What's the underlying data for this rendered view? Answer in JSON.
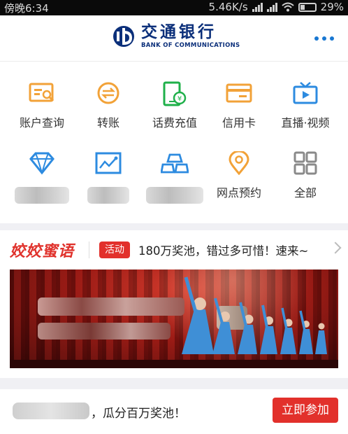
{
  "status_bar": {
    "time": "傍晚6:34",
    "network_speed": "5.46K/s",
    "battery": "29%"
  },
  "header": {
    "logo_cn": "交通银行",
    "logo_en": "BANK OF COMMUNICATIONS"
  },
  "menu_items": [
    {
      "label": "账户查询",
      "icon": "account-query-icon"
    },
    {
      "label": "转账",
      "icon": "transfer-icon"
    },
    {
      "label": "话费充值",
      "icon": "phone-recharge-icon"
    },
    {
      "label": "信用卡",
      "icon": "credit-card-icon"
    },
    {
      "label": "直播·视频",
      "icon": "live-video-icon"
    },
    {
      "label": "",
      "icon": "diamond-icon",
      "blurred": true
    },
    {
      "label": "",
      "icon": "chart-icon",
      "blurred": true
    },
    {
      "label": "",
      "icon": "gold-bars-icon",
      "blurred": true
    },
    {
      "label": "网点预约",
      "icon": "location-pin-icon"
    },
    {
      "label": "全部",
      "icon": "all-grid-icon"
    }
  ],
  "promo": {
    "brand": "姣姣蜜语",
    "tag": "活动",
    "text": "180万奖池，错过多可惜！速来~"
  },
  "bottom": {
    "text": "，瓜分百万奖池！",
    "button": "立即参加"
  },
  "colors": {
    "orange_icon": "#f2a238",
    "green_icon": "#1fb04a",
    "blue_icon": "#2d8be0",
    "gray_icon": "#8a8a8a",
    "accent_red": "#e2302b",
    "brand_blue": "#0b2f7a"
  }
}
